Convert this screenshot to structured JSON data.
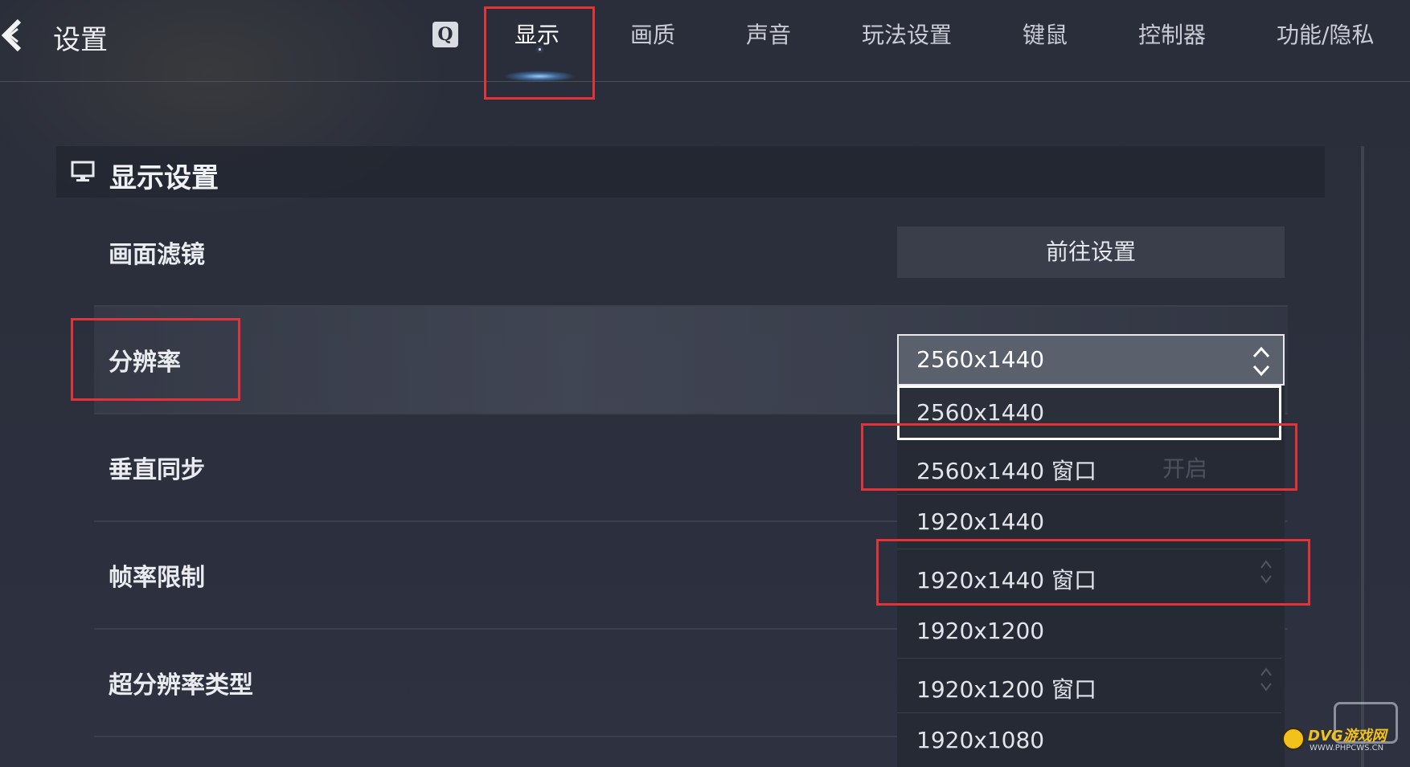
{
  "header": {
    "title": "设置",
    "search_key": "Q",
    "tabs": [
      {
        "label": "显示",
        "active": true
      },
      {
        "label": "画质"
      },
      {
        "label": "声音"
      },
      {
        "label": "玩法设置"
      },
      {
        "label": "键鼠"
      },
      {
        "label": "控制器"
      },
      {
        "label": "功能/隐私"
      }
    ]
  },
  "section": {
    "title": "显示设置",
    "icon": "monitor-icon"
  },
  "settings": {
    "filter": {
      "label": "画面滤镜",
      "button": "前往设置"
    },
    "resolution": {
      "label": "分辨率",
      "value": "2560x1440",
      "options": [
        "2560x1440",
        "2560x1440 窗口",
        "1920x1440",
        "1920x1440 窗口",
        "1920x1200",
        "1920x1200 窗口",
        "1920x1080"
      ],
      "selected_index": 0
    },
    "vsync": {
      "label": "垂直同步",
      "value": "开启"
    },
    "frame_limit": {
      "label": "帧率限制"
    },
    "super_resolution": {
      "label": "超分辨率类型"
    }
  },
  "watermark": {
    "name": "DVG游戏网",
    "url": "WWW.PHPCWS.CN"
  },
  "colors": {
    "background": "#2b2f3b",
    "highlight_red": "#e0343b",
    "watermark_yellow": "#f2c21b"
  }
}
